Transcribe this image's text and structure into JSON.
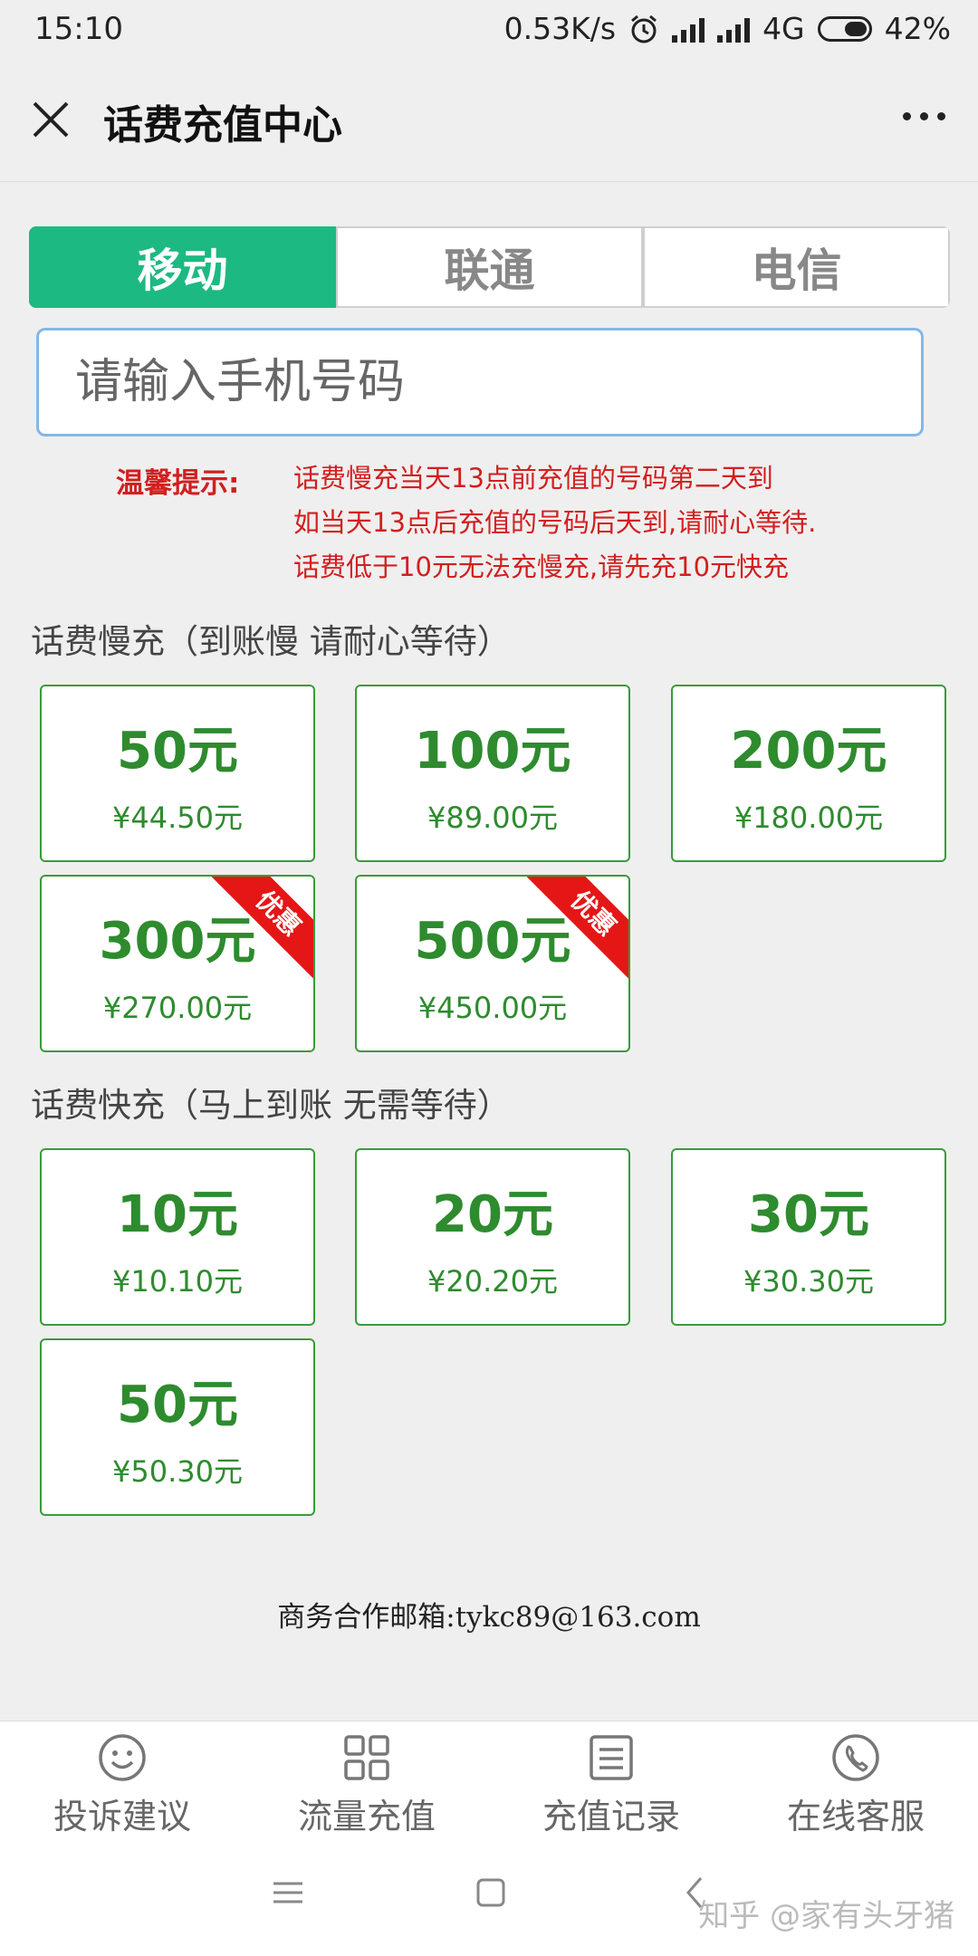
{
  "status_bar": {
    "time": "15:10",
    "net_speed": "0.53K/s",
    "network": "4G",
    "battery": "42%"
  },
  "header": {
    "title": "话费充值中心"
  },
  "carrier_tabs": [
    {
      "label": "移动",
      "active": true
    },
    {
      "label": "联通",
      "active": false
    },
    {
      "label": "电信",
      "active": false
    }
  ],
  "phone_input": {
    "placeholder": "请输入手机号码",
    "value": ""
  },
  "notice": {
    "label": "温馨提示:",
    "lines": [
      "话费慢充当天13点前充值的号码第二天到",
      "如当天13点后充值的号码后天到,请耐心等待.",
      "话费低于10元无法充慢充,请先充10元快充"
    ]
  },
  "slow_recharge": {
    "title": "话费慢充（到账慢 请耐心等待）",
    "options": [
      {
        "face": "50元",
        "price": "¥44.50元"
      },
      {
        "face": "100元",
        "price": "¥89.00元"
      },
      {
        "face": "200元",
        "price": "¥180.00元"
      },
      {
        "face": "300元",
        "price": "¥270.00元",
        "badge": "优惠"
      },
      {
        "face": "500元",
        "price": "¥450.00元",
        "badge": "优惠"
      }
    ]
  },
  "fast_recharge": {
    "title": "话费快充（马上到账 无需等待）",
    "options": [
      {
        "face": "10元",
        "price": "¥10.10元"
      },
      {
        "face": "20元",
        "price": "¥20.20元"
      },
      {
        "face": "30元",
        "price": "¥30.30元"
      },
      {
        "face": "50元",
        "price": "¥50.30元"
      }
    ]
  },
  "footer": {
    "email_text": "商务合作邮箱:tykc89@163.com"
  },
  "bottom_nav": [
    {
      "label": "投诉建议",
      "icon": "smile-icon"
    },
    {
      "label": "流量充值",
      "icon": "grid-icon"
    },
    {
      "label": "充值记录",
      "icon": "list-icon"
    },
    {
      "label": "在线客服",
      "icon": "phone-icon"
    }
  ],
  "watermark": "知乎 @家有头牙猪",
  "colors": {
    "accent": "#1db983",
    "price_green": "#2e8b2e",
    "notice_red": "#d21f1f",
    "badge_red": "#e51616"
  }
}
